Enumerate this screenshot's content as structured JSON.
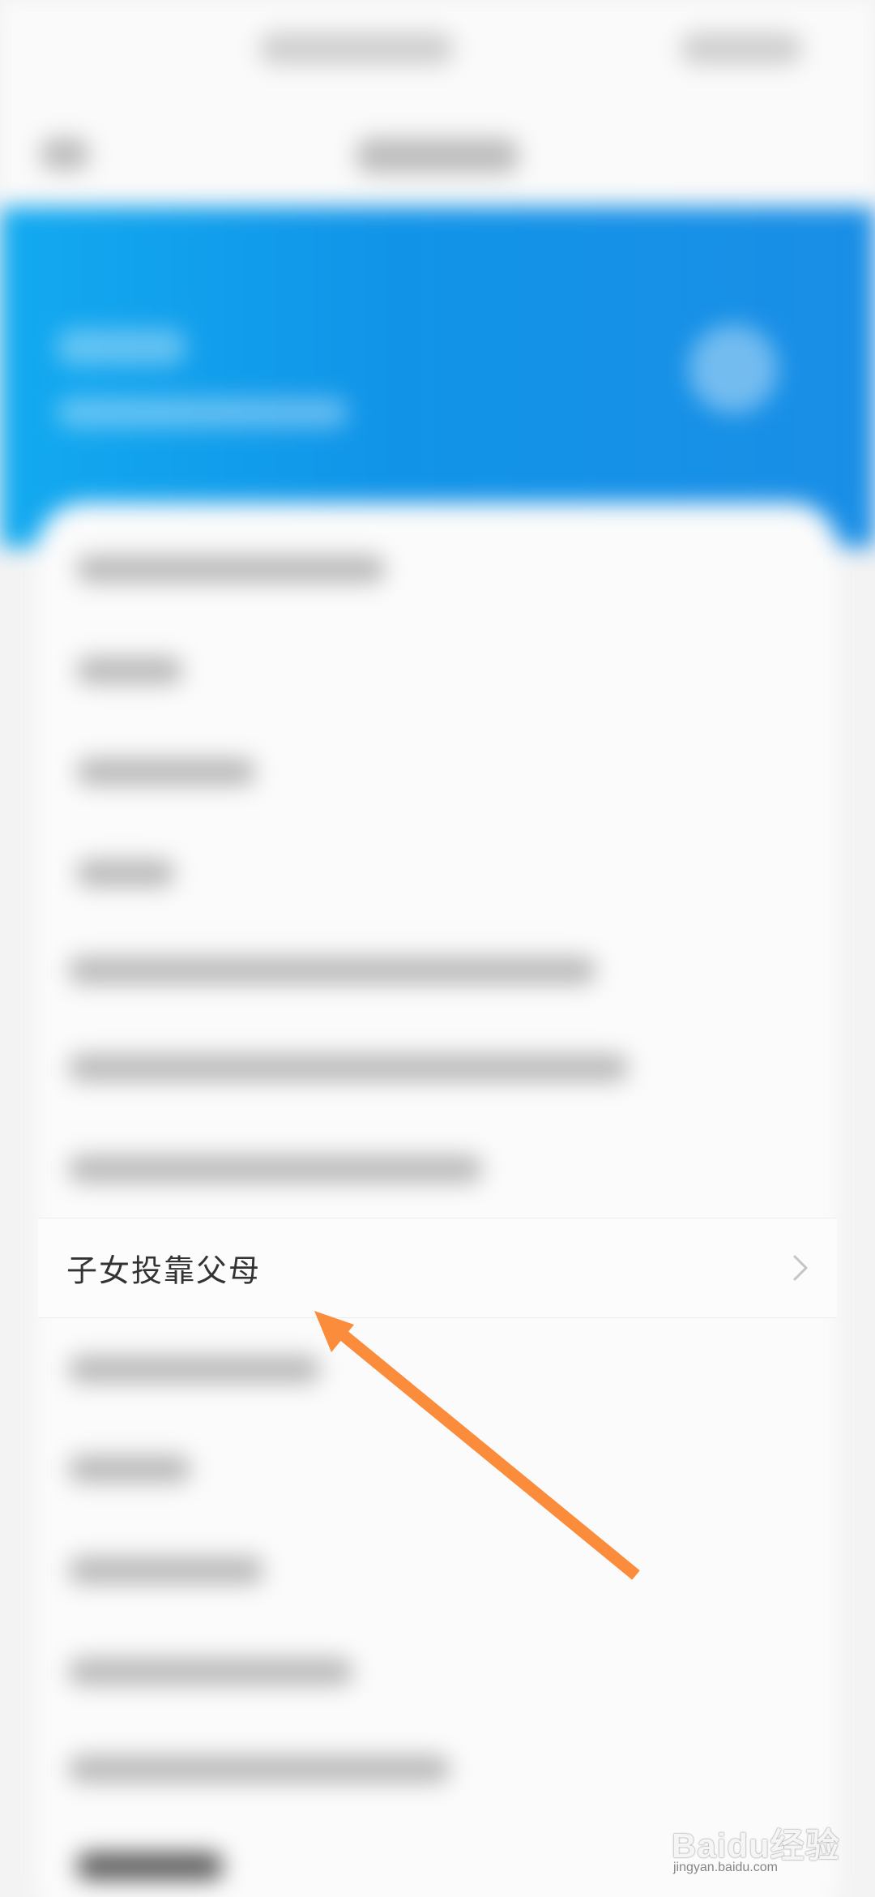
{
  "list": {
    "highlighted_item": {
      "label": "子女投靠父母",
      "chevron_icon": "chevron-right-icon"
    }
  },
  "annotation": {
    "arrow_icon": "arrow-pointer-icon",
    "arrow_color": "#fb8c3b"
  },
  "watermark": {
    "brand": "Baidu经验",
    "domain": "jingyan.baidu.com"
  },
  "colors": {
    "hero_blue": "#1194e8",
    "background": "#f3f3f3",
    "card": "#fbfbfb",
    "text": "#333333"
  }
}
